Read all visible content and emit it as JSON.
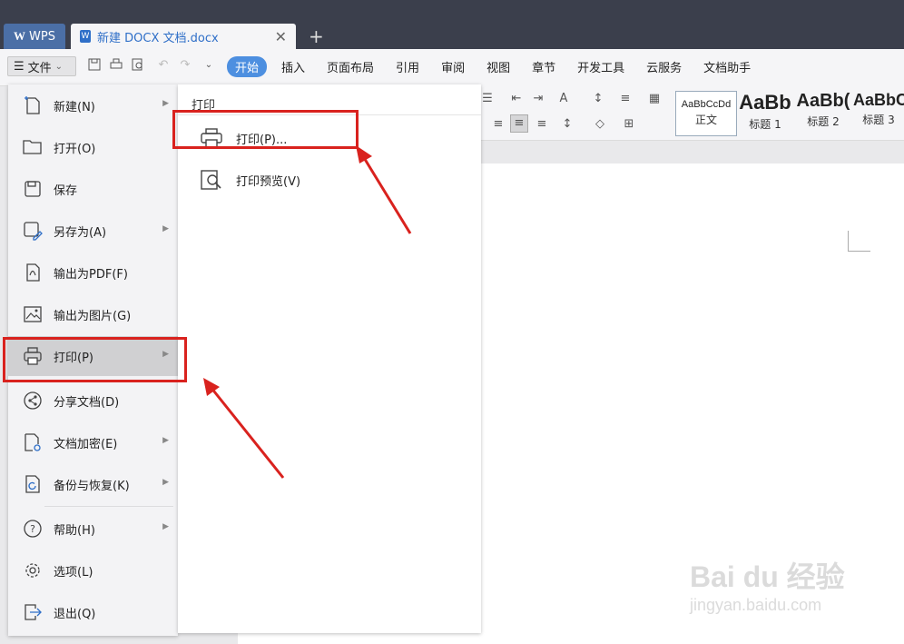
{
  "tabs": {
    "app_label": "WPS",
    "document_title": "新建 DOCX 文档.docx",
    "close": "✕",
    "add": "+"
  },
  "toolbar": {
    "file_label": "文件",
    "menu_tabs": [
      "开始",
      "插入",
      "页面布局",
      "引用",
      "审阅",
      "视图",
      "章节",
      "开发工具",
      "云服务",
      "文档助手"
    ]
  },
  "styles": [
    {
      "sample": "AaBbCcDd",
      "label": "正文"
    },
    {
      "sample": "AaBb",
      "label": "标题 1"
    },
    {
      "sample": "AaBb(",
      "label": "标题 2"
    },
    {
      "sample": "AaBbC",
      "label": "标题 3"
    }
  ],
  "file_menu": {
    "items": [
      {
        "label": "新建(N)",
        "icon": "new-doc-icon",
        "arrow": true
      },
      {
        "label": "打开(O)",
        "icon": "folder-icon",
        "arrow": false
      },
      {
        "label": "保存",
        "icon": "save-icon",
        "arrow": false
      },
      {
        "label": "另存为(A)",
        "icon": "save-as-icon",
        "arrow": true
      },
      {
        "label": "输出为PDF(F)",
        "icon": "pdf-icon",
        "arrow": false
      },
      {
        "label": "输出为图片(G)",
        "icon": "image-icon",
        "arrow": false
      },
      {
        "label": "打印(P)",
        "icon": "printer-icon",
        "arrow": true,
        "selected": true
      },
      {
        "label": "分享文档(D)",
        "icon": "share-icon",
        "arrow": false
      },
      {
        "label": "文档加密(E)",
        "icon": "lock-doc-icon",
        "arrow": true
      },
      {
        "label": "备份与恢复(K)",
        "icon": "backup-icon",
        "arrow": true
      },
      {
        "label": "帮助(H)",
        "icon": "help-icon",
        "arrow": true
      },
      {
        "label": "选项(L)",
        "icon": "gear-icon",
        "arrow": false
      },
      {
        "label": "退出(Q)",
        "icon": "exit-icon",
        "arrow": false
      }
    ]
  },
  "print_submenu": {
    "header": "打印",
    "items": [
      {
        "label": "打印(P)...",
        "icon": "printer-icon"
      },
      {
        "label": "打印预览(V)",
        "icon": "print-preview-icon"
      }
    ]
  },
  "watermark": {
    "brand": "Bai du 经验",
    "url": "jingyan.baidu.com"
  },
  "colors": {
    "accent": "#4d8fe0",
    "highlight": "#d9221e",
    "titlebar": "#3b3f4c"
  }
}
